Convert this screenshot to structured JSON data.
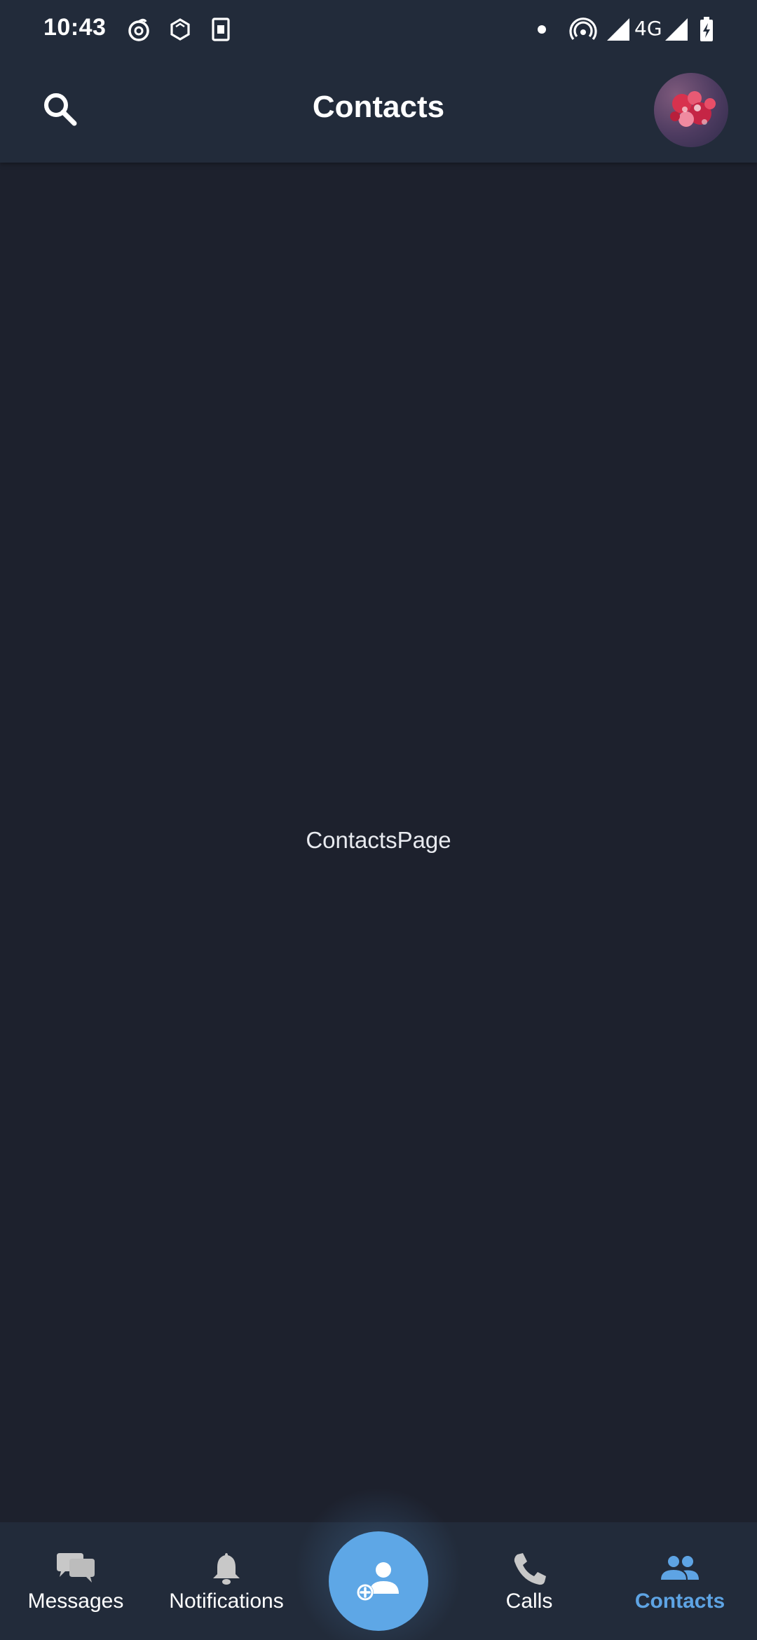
{
  "status_bar": {
    "time": "10:43",
    "network": "4G",
    "icons": [
      "whirl-icon",
      "hexagon-icon",
      "sim-card-icon",
      "dot-icon",
      "hotspot-icon",
      "signal-icon",
      "signal-icon-2",
      "battery-charging-icon"
    ]
  },
  "app_bar": {
    "title": "Contacts",
    "search_icon": "search-icon",
    "avatar": "profile-avatar"
  },
  "main": {
    "placeholder": "ContactsPage"
  },
  "bottom_nav": {
    "items": [
      {
        "label": "Messages",
        "icon": "chat-bubbles-icon",
        "active": false
      },
      {
        "label": "Notifications",
        "icon": "bell-icon",
        "active": false
      },
      {
        "label": "Calls",
        "icon": "phone-icon",
        "active": false
      },
      {
        "label": "Contacts",
        "icon": "people-icon",
        "active": true
      }
    ],
    "fab_icon": "add-contact-icon"
  },
  "colors": {
    "background": "#1d212d",
    "bars": "#222b3a",
    "accent": "#5ea7e6",
    "inactive_icon": "#c8c8c8"
  }
}
